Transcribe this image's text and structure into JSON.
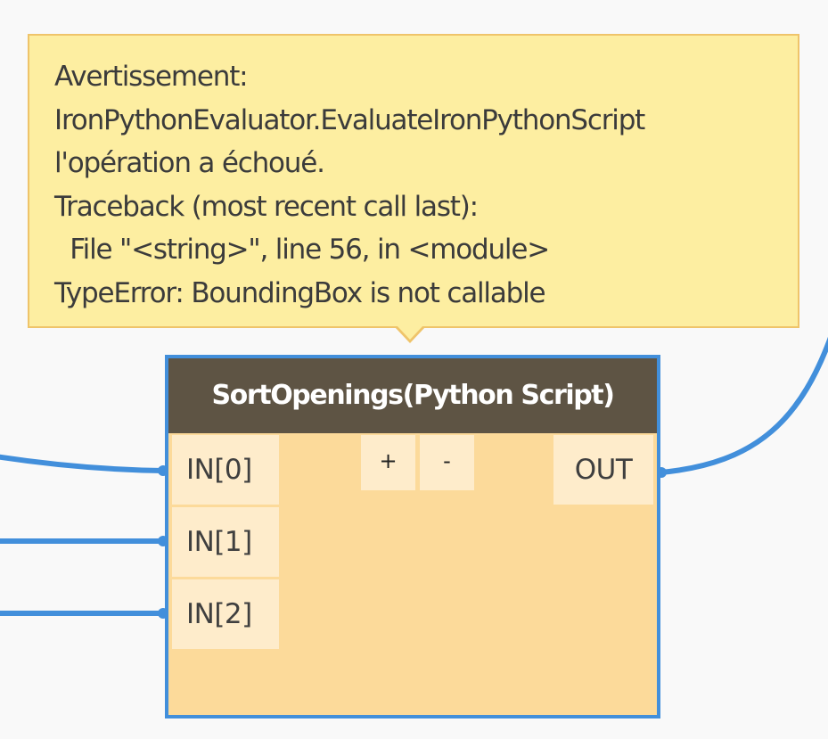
{
  "tooltip": {
    "severity": "warning",
    "lines": [
      "Avertissement:",
      "IronPythonEvaluator.EvaluateIronPythonScript",
      "l'opération a échoué.",
      "Traceback (most recent call last):",
      "  File \"<string>\", line 56, in <module>",
      "TypeError: BoundingBox is not callable"
    ]
  },
  "node": {
    "title": "SortOpenings(Python Script)",
    "inputs": [
      "IN[0]",
      "IN[1]",
      "IN[2]"
    ],
    "output": "OUT",
    "add_input_label": "+",
    "remove_input_label": "-"
  },
  "colors": {
    "wire": "#428fdb",
    "node_border": "#428fdb",
    "node_header": "#5e5444",
    "node_body": "#fcda9a",
    "port": "#feeccb",
    "tooltip_bg": "#fdeea1",
    "tooltip_border": "#efc46a"
  }
}
